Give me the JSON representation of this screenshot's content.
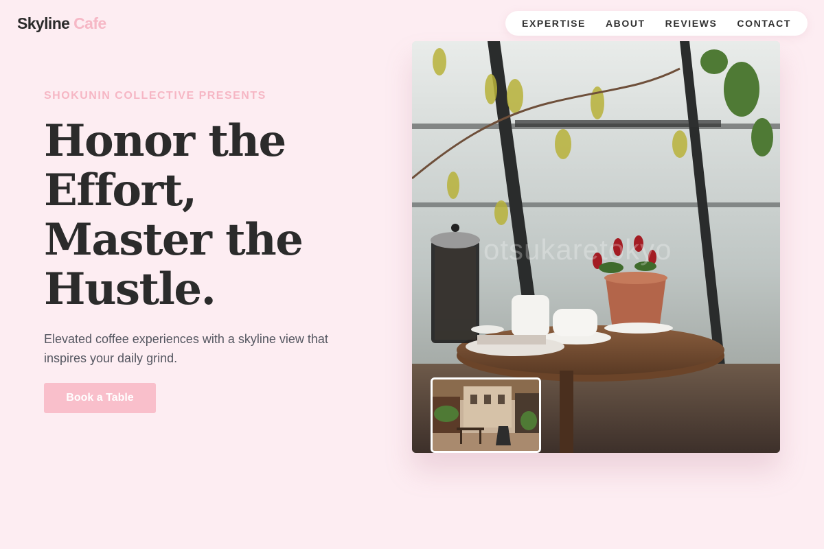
{
  "brand": {
    "name_part1": "Skyline",
    "name_part2": "Cafe"
  },
  "nav": {
    "items": [
      {
        "label": "EXPERTISE"
      },
      {
        "label": "ABOUT"
      },
      {
        "label": "REVIEWS"
      },
      {
        "label": "CONTACT"
      }
    ]
  },
  "hero": {
    "eyebrow": "SHOKUNIN COLLECTIVE PRESENTS",
    "headline_lines": [
      "Honor the",
      "Effort,",
      "Master the",
      "Hustle."
    ],
    "subtext": "Elevated coffee experiences with a skyline view that inspires your daily grind.",
    "cta_label": "Book a Table"
  },
  "media": {
    "watermark": "otsukaretokyo"
  },
  "colors": {
    "background": "#fdedf2",
    "accent_pink": "#f6b8c6",
    "button_pink": "#f9bfcb",
    "text_dark": "#2b2b2b",
    "text_muted": "#555761"
  }
}
